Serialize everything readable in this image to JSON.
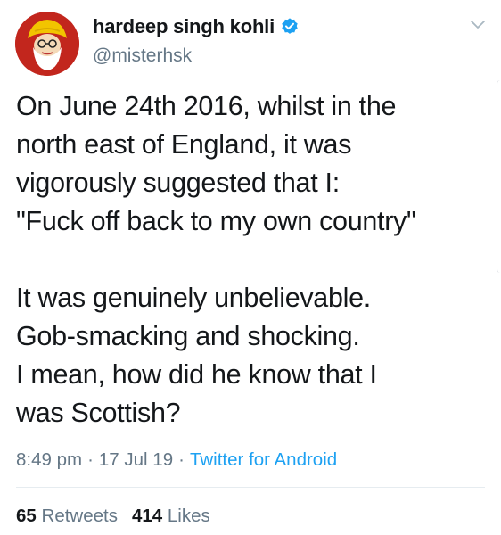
{
  "tweet": {
    "author": {
      "display_name": "hardeep singh kohli",
      "handle": "@misterhsk",
      "verified_icon": "verified-badge-icon",
      "avatar_icon": "avatar-illustration",
      "menu_icon": "chevron-down-icon"
    },
    "text_lines": [
      "On June 24th 2016, whilst in the",
      "north east of England, it was",
      "vigorously suggested that I:",
      "\"Fuck off back to my own country\"",
      "It was genuinely unbelievable.",
      "Gob-smacking and shocking.",
      "I mean, how did he know that I",
      "was Scottish?"
    ],
    "meta": {
      "time": "8:49 pm",
      "separator": "·",
      "date": "17 Jul 19",
      "source": "Twitter for Android"
    },
    "stats": {
      "retweets_count": "65",
      "retweets_label": "Retweets",
      "likes_count": "414",
      "likes_label": "Likes"
    },
    "colors": {
      "text": "#14171a",
      "secondary": "#657786",
      "accent": "#1da1f2",
      "avatar_background": "#c2261d"
    }
  }
}
